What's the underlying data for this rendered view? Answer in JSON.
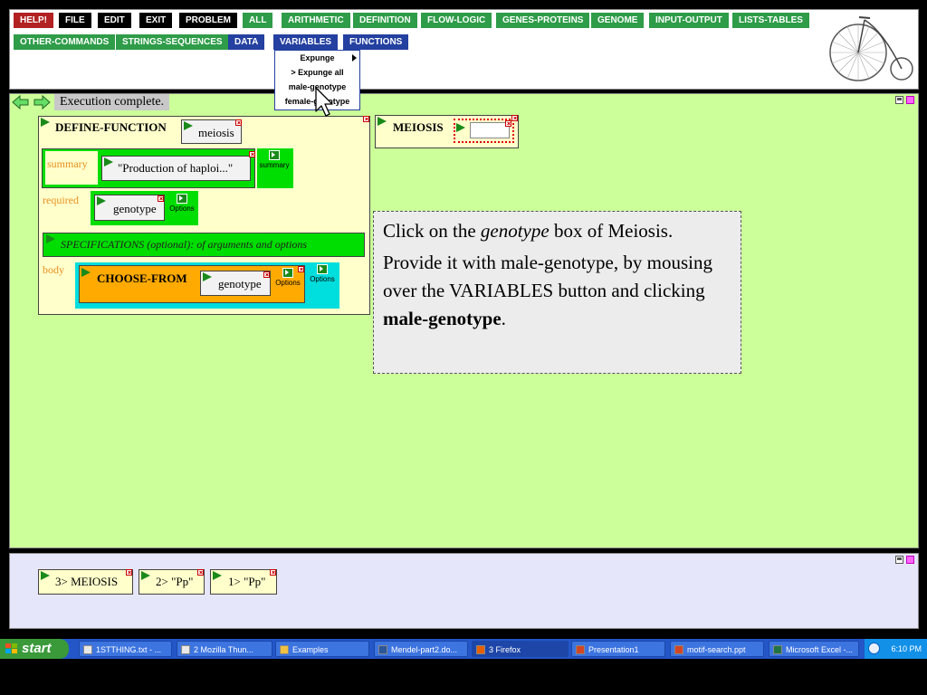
{
  "toolbar": {
    "row1": [
      "HELP!",
      "FILE",
      "EDIT",
      "EXIT",
      "PROBLEM",
      "ALL",
      "ARITHMETIC",
      "DEFINITION",
      "FLOW-LOGIC",
      "GENES-PROTEINS",
      "GENOME",
      "INPUT-OUTPUT",
      "LISTS-TABLES"
    ],
    "row2": [
      "OTHER-COMMANDS",
      "STRINGS-SEQUENCES",
      "DATA",
      "VARIABLES",
      "FUNCTIONS"
    ]
  },
  "dropdown": {
    "items": [
      "Expunge",
      "> Expunge all",
      "male-genotype",
      "female-genotype"
    ]
  },
  "status": {
    "text": "Execution complete."
  },
  "define": {
    "keyword": "DEFINE-FUNCTION",
    "name": "meiosis",
    "summary_label": "summary",
    "summary_value": "\"Production of haploi...\"",
    "summary_btn": "summary",
    "required_label": "required",
    "required_value": "genotype",
    "options_btn": "Options",
    "specifications": "SPECIFICATIONS (optional): of arguments and options",
    "body_label": "body",
    "choose_keyword": "CHOOSE-FROM",
    "choose_arg": "genotype"
  },
  "meiosis_call": {
    "label": "MEIOSIS"
  },
  "instruction": {
    "p1_pre": "Click on the ",
    "p1_em": "genotype",
    "p1_post": " box of Meiosis.",
    "p2_pre": "Provide it with male-genotype, by mousing over the VARIABLES button and clicking ",
    "p2_bold": "male-genotype",
    "p2_post": "."
  },
  "history": [
    "3> MEIOSIS",
    "2> \"Pp\"",
    "1> \"Pp\""
  ],
  "taskbar": {
    "start": "start",
    "tasks": [
      "1STTHING.txt - ...",
      "2 Mozilla Thun...",
      "Examples",
      "Mendel-part2.do...",
      "3 Firefox",
      "Presentation1",
      "motif-search.ppt",
      "Microsoft Excel -..."
    ],
    "clock": "6:10 PM"
  },
  "colors": {
    "workspace": "#ccff99",
    "history_bg": "#e6e6fa",
    "define_bg": "#ffffcc",
    "green_slot": "#00dd00",
    "choose_bg": "#ffaa00",
    "body_bg": "#00dddd",
    "taskbar": "#2456c8"
  }
}
